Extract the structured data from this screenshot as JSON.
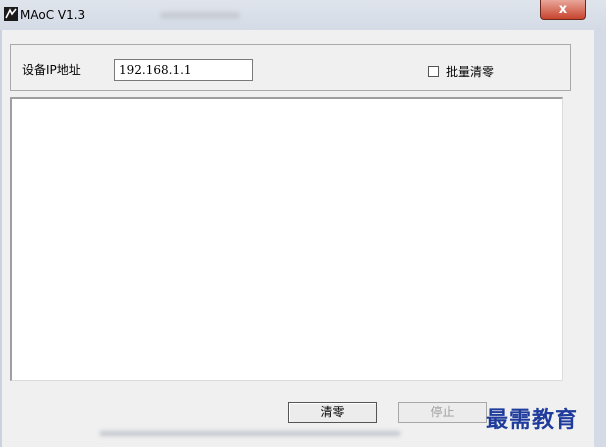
{
  "window": {
    "title": "MAoC V1.3",
    "close_label": "x"
  },
  "settings": {
    "ip_label": "设备IP地址",
    "ip_value": "192.168.1.1",
    "batch_clear_label": "批量清零",
    "batch_clear_checked": false
  },
  "log": {
    "content": ""
  },
  "buttons": {
    "clear_label": "清零",
    "stop_label": "停止"
  },
  "watermark": {
    "text": "最需教育"
  }
}
